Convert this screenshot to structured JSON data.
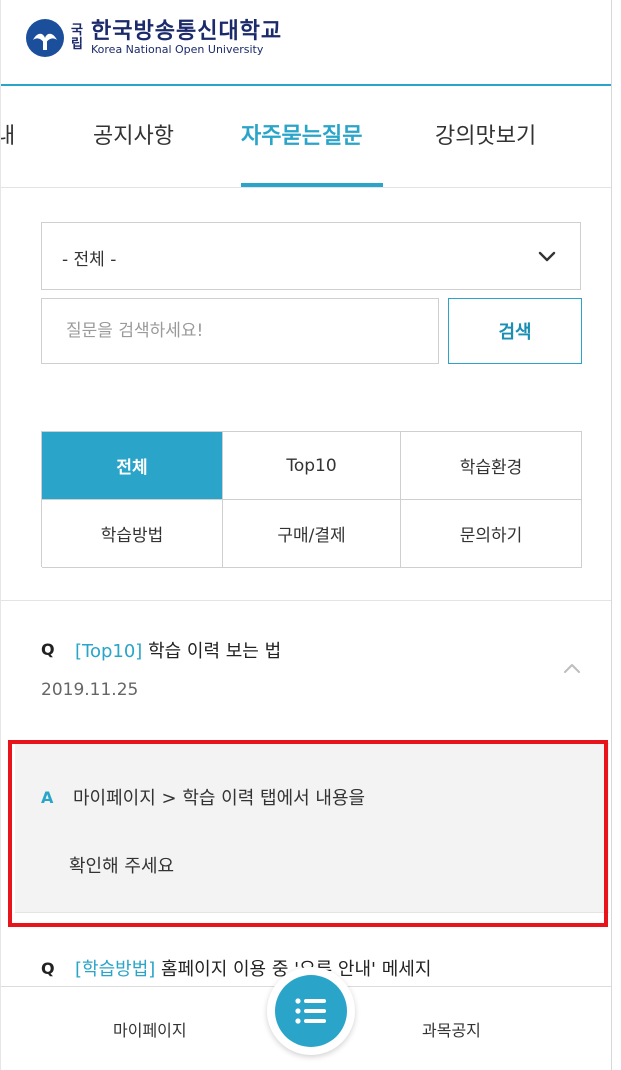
{
  "header": {
    "logo_gov": "국립",
    "logo_ko": "한국방송통신대학교",
    "logo_en": "Korea National Open University"
  },
  "tabs": [
    {
      "label": "내",
      "active": false
    },
    {
      "label": "공지사항",
      "active": false
    },
    {
      "label": "자주묻는질문",
      "active": true
    },
    {
      "label": "강의맛보기",
      "active": false
    }
  ],
  "filter": {
    "selected": "- 전체 -"
  },
  "search": {
    "placeholder": "질문을 검색하세요!",
    "button_label": "검색"
  },
  "categories": [
    {
      "label": "전체",
      "active": true
    },
    {
      "label": "Top10",
      "active": false
    },
    {
      "label": "학습환경",
      "active": false
    },
    {
      "label": "학습방법",
      "active": false
    },
    {
      "label": "구매/결제",
      "active": false
    },
    {
      "label": "문의하기",
      "active": false
    }
  ],
  "faq": [
    {
      "q_mark": "Q",
      "category": "[Top10]",
      "question": "학습 이력 보는 법",
      "date": "2019.11.25",
      "answer_mark": "A",
      "answer_line1": "마이페이지 > 학습 이력 탭에서 내용을",
      "answer_line2": "확인해 주세요"
    },
    {
      "q_mark": "Q",
      "category": "[학습방법]",
      "question": "홈페이지 이용 중 '오류 안내' 메세지"
    }
  ],
  "bottom_nav": {
    "left_label": "마이페이지",
    "right_label": "과목공지",
    "fab_icon": "list-menu-icon"
  },
  "colors": {
    "accent": "#2aa5c9",
    "highlight": "#e8141c",
    "logo_navy": "#1b2a6b"
  }
}
